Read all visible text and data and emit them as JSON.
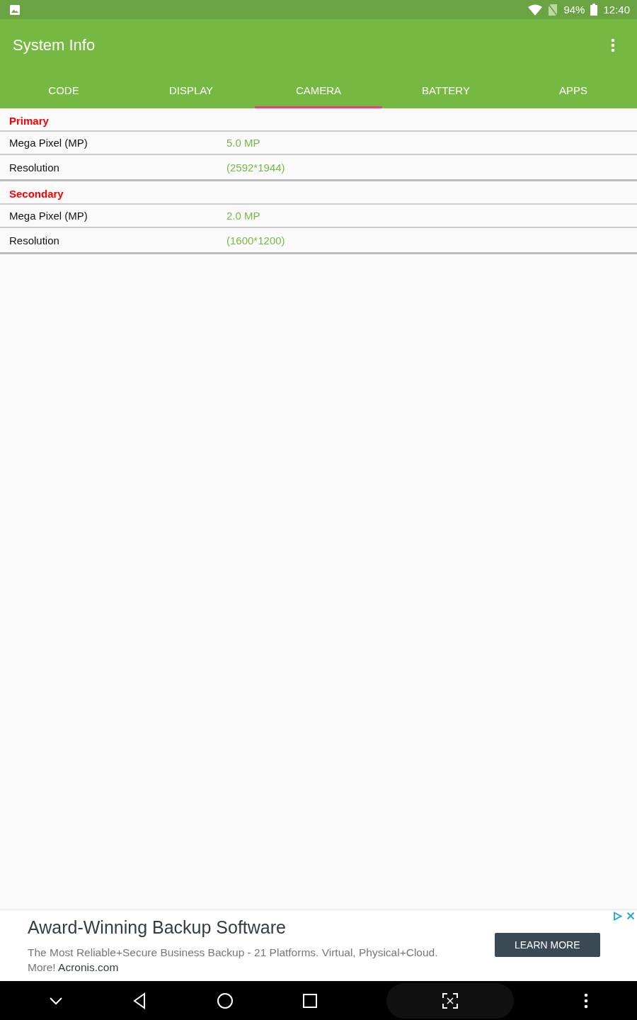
{
  "status_bar": {
    "battery": "94%",
    "time": "12:40"
  },
  "app_bar": {
    "title": "System Info"
  },
  "tabs": [
    {
      "label": "CODE",
      "selected": false
    },
    {
      "label": "DISPLAY",
      "selected": false
    },
    {
      "label": "CAMERA",
      "selected": true
    },
    {
      "label": "BATTERY",
      "selected": false
    },
    {
      "label": "APPS",
      "selected": false
    }
  ],
  "sections": [
    {
      "title": "Primary",
      "rows": [
        {
          "label": "Mega Pixel (MP)",
          "value": "5.0 MP"
        },
        {
          "label": "Resolution",
          "value": "(2592*1944)"
        }
      ]
    },
    {
      "title": "Secondary",
      "rows": [
        {
          "label": "Mega Pixel (MP)",
          "value": "2.0 MP"
        },
        {
          "label": "Resolution",
          "value": "(1600*1200)"
        }
      ]
    }
  ],
  "ad": {
    "title": "Award-Winning Backup Software",
    "description": "The Most Reliable+Secure Business Backup - 21 Platforms. Virtual, Physical+Cloud. More!",
    "domain": "Acronis.com",
    "button": "LEARN MORE"
  }
}
